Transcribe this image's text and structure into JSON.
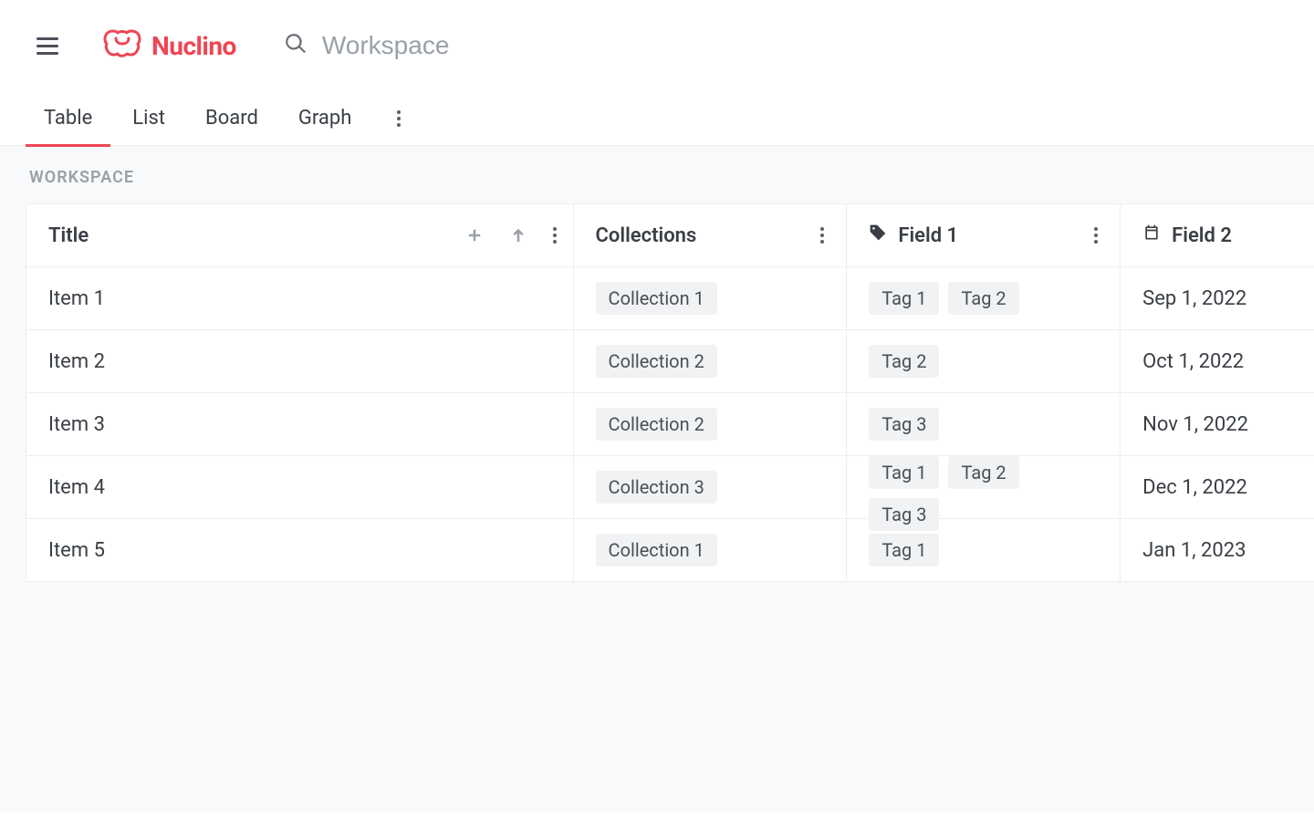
{
  "app": {
    "name": "Nuclino",
    "search_placeholder": "Workspace"
  },
  "tabs": {
    "items": [
      "Table",
      "List",
      "Board",
      "Graph"
    ],
    "active_index": 0
  },
  "section": {
    "label": "WORKSPACE"
  },
  "table": {
    "columns": {
      "title": "Title",
      "collections": "Collections",
      "field1": "Field 1",
      "field2": "Field 2"
    },
    "rows": [
      {
        "title": "Item 1",
        "collection": "Collection 1",
        "tags": [
          "Tag 1",
          "Tag 2"
        ],
        "date": "Sep 1, 2022"
      },
      {
        "title": "Item 2",
        "collection": "Collection 2",
        "tags": [
          "Tag 2"
        ],
        "date": "Oct 1, 2022"
      },
      {
        "title": "Item 3",
        "collection": "Collection 2",
        "tags": [
          "Tag 3"
        ],
        "date": "Nov 1, 2022"
      },
      {
        "title": "Item 4",
        "collection": "Collection 3",
        "tags": [
          "Tag 1",
          "Tag 2",
          "Tag 3"
        ],
        "date": "Dec 1, 2022"
      },
      {
        "title": "Item 5",
        "collection": "Collection 1",
        "tags": [
          "Tag 1"
        ],
        "date": "Jan 1, 2023"
      }
    ]
  }
}
